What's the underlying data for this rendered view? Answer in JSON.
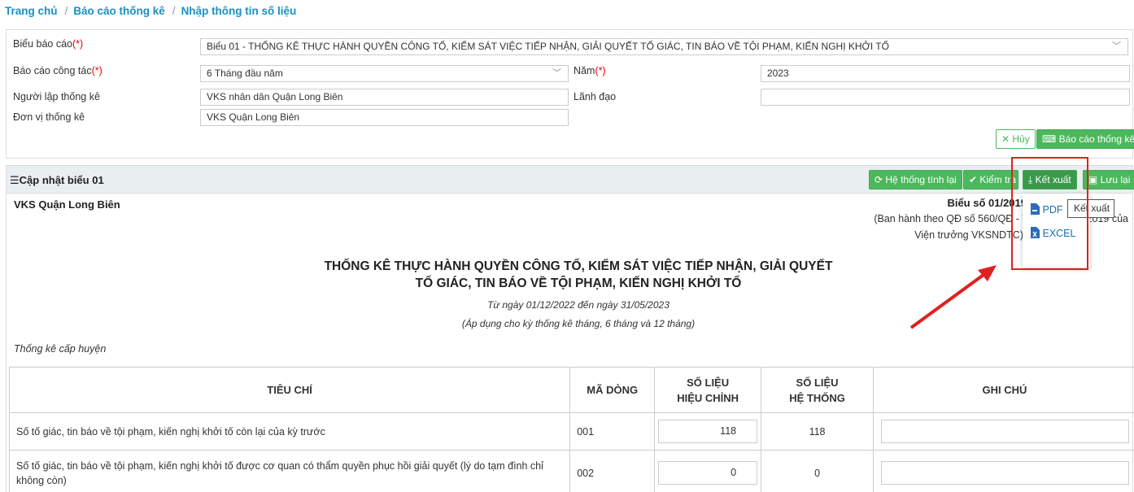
{
  "breadcrumb": [
    "Trang chủ",
    "Báo cáo thống kê",
    "Nhập thông tin số liệu"
  ],
  "filters": {
    "bieu_bao_cao_label": "Biểu báo cáo",
    "bieu_bao_cao_value": "Biểu 01 - THỐNG KÊ THỰC HÀNH QUYỀN CÔNG TỐ, KIỂM SÁT VIỆC TIẾP NHẬN, GIẢI QUYẾT TỐ GIÁC, TIN BÁO VỀ TỘI PHẠM, KIẾN NGHỊ KHỞI TỐ",
    "bao_cao_cong_tac_label": "Báo cáo công tác",
    "bao_cao_cong_tac_value": "6 Tháng đầu năm",
    "nam_label": "Năm",
    "nam_value": "2023",
    "nguoi_lap_label": "Người lập thống kê",
    "nguoi_lap_value": "VKS nhân dân Quận Long Biên",
    "lanh_dao_label": "Lãnh đạo",
    "lanh_dao_value": "",
    "don_vi_label": "Đơn vị thống kê",
    "don_vi_value": "VKS Quận Long Biên",
    "required_mark": "(*)"
  },
  "actions": {
    "cancel": "Hủy",
    "report": "Báo cáo thống kê"
  },
  "section": {
    "title": "Cập nhật biểu 01",
    "btn_recalc": "Hệ thống tính lại",
    "btn_check": "Kiểm tra",
    "btn_export": "Kết xuất",
    "btn_save": "Lưu lại"
  },
  "export_menu": {
    "pdf": "PDF",
    "excel": "EXCEL",
    "tooltip": "Kết xuất"
  },
  "report": {
    "org": "VKS Quận Long Biên",
    "form_no": "Biểu số 01/2019",
    "form_note1": "(Ban hành theo QĐ số 560/QĐ - VKSTC ngày        /2019 của",
    "form_note2": "Viện trưởng VKSNDTC)",
    "title1": "THỐNG KÊ THỰC HÀNH QUYỀN CÔNG TỐ, KIỂM SÁT VIỆC TIẾP NHẬN, GIẢI QUYẾT",
    "title2": "TỐ GIÁC, TIN BÁO VỀ TỘI PHẠM, KIẾN NGHỊ KHỞI TỐ",
    "period": "Từ ngày 01/12/2022 đến ngày 31/05/2023",
    "applies": "(Áp dụng cho kỳ thống kê tháng, 6 tháng và 12 tháng)",
    "level": "Thống kê cấp huyện"
  },
  "table": {
    "headers": {
      "criteria": "TIÊU CHÍ",
      "code": "MÃ DÒNG",
      "adjusted_1": "SỐ LIỆU",
      "adjusted_2": "HIỆU CHỈNH",
      "system_1": "SỐ LIỆU",
      "system_2": "HỆ THỐNG",
      "note": "GHI CHÚ"
    },
    "rows": [
      {
        "criteria": "Số tố giác, tin báo về tội phạm, kiến nghị khởi tố còn lại của kỳ trước",
        "code": "001",
        "adjusted": "118",
        "system": "118"
      },
      {
        "criteria": "Số tố giác, tin báo về tội phạm, kiến nghị khởi tố được cơ quan có thẩm quyền phục hồi giải quyết (lý do tạm đình chỉ không còn)",
        "code": "002",
        "adjusted": "0",
        "system": "0"
      }
    ]
  },
  "colors": {
    "link": "#1a8fc2",
    "green": "#4cb85c",
    "required": "#e00000",
    "highlight": "#e02020"
  }
}
